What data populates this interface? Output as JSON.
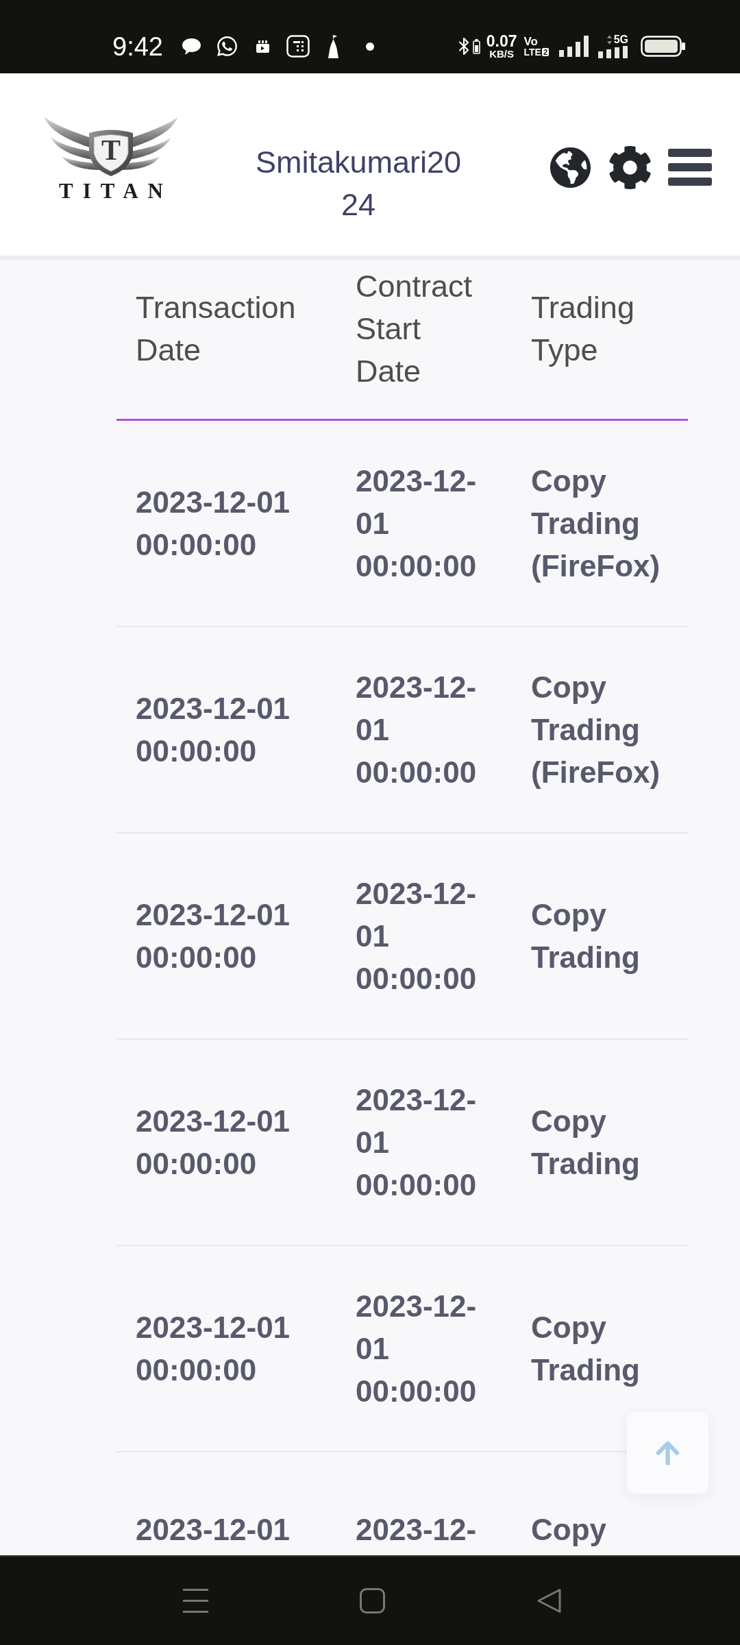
{
  "status_bar": {
    "time": "9:42",
    "data_speed": "0.07",
    "data_speed_unit": "KB/S",
    "volte": "Vo",
    "volte_network": "LTE",
    "sim_slot": "2",
    "network_type": "5G"
  },
  "header": {
    "logo_letter": "T",
    "logo_name": "TITAN",
    "username": "Smitakumari2024"
  },
  "table": {
    "columns": [
      "Transaction Date",
      "Contract Start Date",
      "Trading Type"
    ],
    "rows": [
      [
        "2023-12-01 00:00:00",
        "2023-12-01 00:00:00",
        "Copy Trading (FireFox)"
      ],
      [
        "2023-12-01 00:00:00",
        "2023-12-01 00:00:00",
        "Copy Trading (FireFox)"
      ],
      [
        "2023-12-01 00:00:00",
        "2023-12-01 00:00:00",
        "Copy Trading"
      ],
      [
        "2023-12-01 00:00:00",
        "2023-12-01 00:00:00",
        "Copy Trading"
      ],
      [
        "2023-12-01 00:00:00",
        "2023-12-01 00:00:00",
        "Copy Trading"
      ],
      [
        "2023-12-01",
        "2023-12-",
        "Copy"
      ]
    ]
  }
}
